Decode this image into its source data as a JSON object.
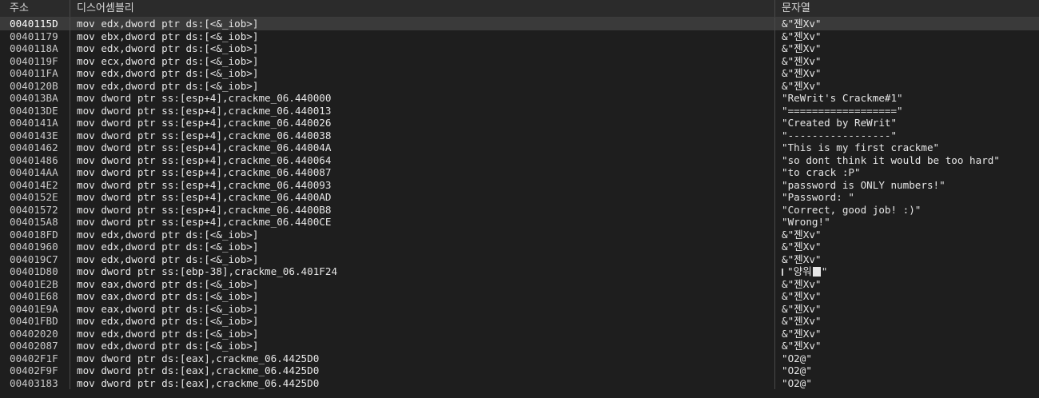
{
  "columns": {
    "address": "주소",
    "disassembly": "디스어셈블리",
    "string": "문자열"
  },
  "rows": [
    {
      "addr": "0040115D",
      "dis": "mov edx,dword ptr ds:[<&_iob>]",
      "str": "&\"젠Xv\"",
      "selected": true
    },
    {
      "addr": "00401179",
      "dis": "mov ebx,dword ptr ds:[<&_iob>]",
      "str": "&\"젠Xv\""
    },
    {
      "addr": "0040118A",
      "dis": "mov edx,dword ptr ds:[<&_iob>]",
      "str": "&\"젠Xv\""
    },
    {
      "addr": "0040119F",
      "dis": "mov ecx,dword ptr ds:[<&_iob>]",
      "str": "&\"젠Xv\""
    },
    {
      "addr": "004011FA",
      "dis": "mov edx,dword ptr ds:[<&_iob>]",
      "str": "&\"젠Xv\""
    },
    {
      "addr": "0040120B",
      "dis": "mov edx,dword ptr ds:[<&_iob>]",
      "str": "&\"젠Xv\""
    },
    {
      "addr": "004013BA",
      "dis": "mov dword ptr ss:[esp+4],crackme_06.440000",
      "str": "\"ReWrit's Crackme#1\""
    },
    {
      "addr": "004013DE",
      "dis": "mov dword ptr ss:[esp+4],crackme_06.440013",
      "str": "\"==================\""
    },
    {
      "addr": "0040141A",
      "dis": "mov dword ptr ss:[esp+4],crackme_06.440026",
      "str": "\"Created by ReWrit\""
    },
    {
      "addr": "0040143E",
      "dis": "mov dword ptr ss:[esp+4],crackme_06.440038",
      "str": "\"-----------------\""
    },
    {
      "addr": "00401462",
      "dis": "mov dword ptr ss:[esp+4],crackme_06.44004A",
      "str": "\"This is my first crackme\""
    },
    {
      "addr": "00401486",
      "dis": "mov dword ptr ss:[esp+4],crackme_06.440064",
      "str": "\"so dont think it would be too hard\""
    },
    {
      "addr": "004014AA",
      "dis": "mov dword ptr ss:[esp+4],crackme_06.440087",
      "str": "\"to crack :P\""
    },
    {
      "addr": "004014E2",
      "dis": "mov dword ptr ss:[esp+4],crackme_06.440093",
      "str": "\"password is ONLY numbers!\""
    },
    {
      "addr": "0040152E",
      "dis": "mov dword ptr ss:[esp+4],crackme_06.4400AD",
      "str": "\"Password: \""
    },
    {
      "addr": "00401572",
      "dis": "mov dword ptr ss:[esp+4],crackme_06.4400B8",
      "str": "\"Correct, good job! :)\""
    },
    {
      "addr": "004015A8",
      "dis": "mov dword ptr ss:[esp+4],crackme_06.4400CE",
      "str": "\"Wrong!\""
    },
    {
      "addr": "004018FD",
      "dis": "mov edx,dword ptr ds:[<&_iob>]",
      "str": "&\"젠Xv\""
    },
    {
      "addr": "00401960",
      "dis": "mov edx,dword ptr ds:[<&_iob>]",
      "str": "&\"젠Xv\""
    },
    {
      "addr": "004019C7",
      "dis": "mov edx,dword ptr ds:[<&_iob>]",
      "str": "&\"젠Xv\""
    },
    {
      "addr": "00401D80",
      "dis": "mov dword ptr ss:[ebp-38],crackme_06.401F24",
      "str": "\"양워",
      "str_tail": "\"",
      "garbled": true
    },
    {
      "addr": "00401E2B",
      "dis": "mov eax,dword ptr ds:[<&_iob>]",
      "str": "&\"젠Xv\""
    },
    {
      "addr": "00401E68",
      "dis": "mov eax,dword ptr ds:[<&_iob>]",
      "str": "&\"젠Xv\""
    },
    {
      "addr": "00401E9A",
      "dis": "mov eax,dword ptr ds:[<&_iob>]",
      "str": "&\"젠Xv\""
    },
    {
      "addr": "00401FBD",
      "dis": "mov edx,dword ptr ds:[<&_iob>]",
      "str": "&\"젠Xv\""
    },
    {
      "addr": "00402020",
      "dis": "mov edx,dword ptr ds:[<&_iob>]",
      "str": "&\"젠Xv\""
    },
    {
      "addr": "00402087",
      "dis": "mov edx,dword ptr ds:[<&_iob>]",
      "str": "&\"젠Xv\""
    },
    {
      "addr": "00402F1F",
      "dis": "mov dword ptr ds:[eax],crackme_06.4425D0",
      "str": "\"O2@\""
    },
    {
      "addr": "00402F9F",
      "dis": "mov dword ptr ds:[eax],crackme_06.4425D0",
      "str": "\"O2@\""
    },
    {
      "addr": "00403183",
      "dis": "mov dword ptr ds:[eax],crackme_06.4425D0",
      "str": "\"O2@\""
    }
  ]
}
